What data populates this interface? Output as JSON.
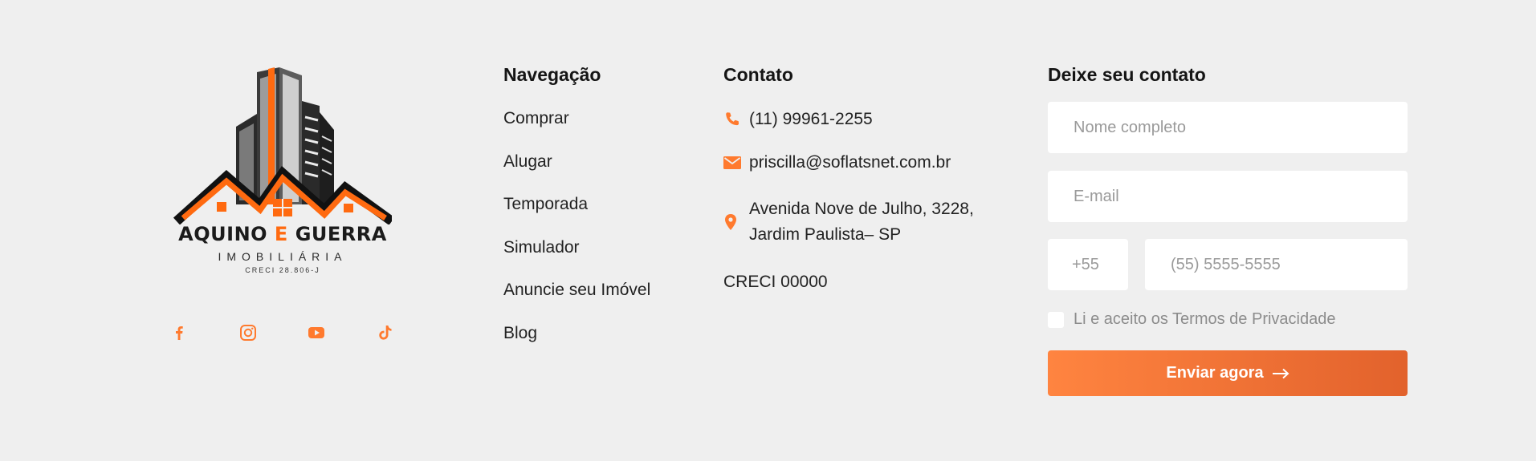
{
  "brand": {
    "name_part1": "AQUINO",
    "name_accent": "E",
    "name_part2": "GUERRA",
    "subtitle": "IMOBILIÁRIA",
    "creci": "CRECI 28.806-J",
    "accent_color": "#ff6a10"
  },
  "social": [
    {
      "name": "facebook-icon"
    },
    {
      "name": "instagram-icon"
    },
    {
      "name": "youtube-icon"
    },
    {
      "name": "tiktok-icon"
    }
  ],
  "navigation": {
    "title": "Navegação",
    "items": [
      {
        "label": "Comprar"
      },
      {
        "label": "Alugar"
      },
      {
        "label": "Temporada"
      },
      {
        "label": "Simulador"
      },
      {
        "label": "Anuncie seu Imóvel"
      },
      {
        "label": "Blog"
      }
    ]
  },
  "contact": {
    "title": "Contato",
    "phone": "(11) 99961-2255",
    "email": "priscilla@soflatsnet.com.br",
    "address_line1": "Avenida Nove de Julho, 3228,",
    "address_line2": "Jardim Paulista– SP",
    "creci": "CRECI 00000"
  },
  "form": {
    "title": "Deixe seu contato",
    "name_placeholder": "Nome completo",
    "email_placeholder": "E-mail",
    "ddi_placeholder": "+55",
    "phone_placeholder": "(55) 5555-5555",
    "terms_label": "Li e aceito os Termos de Privacidade",
    "submit_label": "Enviar agora"
  },
  "colors": {
    "background": "#efefef",
    "accent": "#ff7a2e",
    "button_start": "#ff8440",
    "button_end": "#e2622c"
  }
}
